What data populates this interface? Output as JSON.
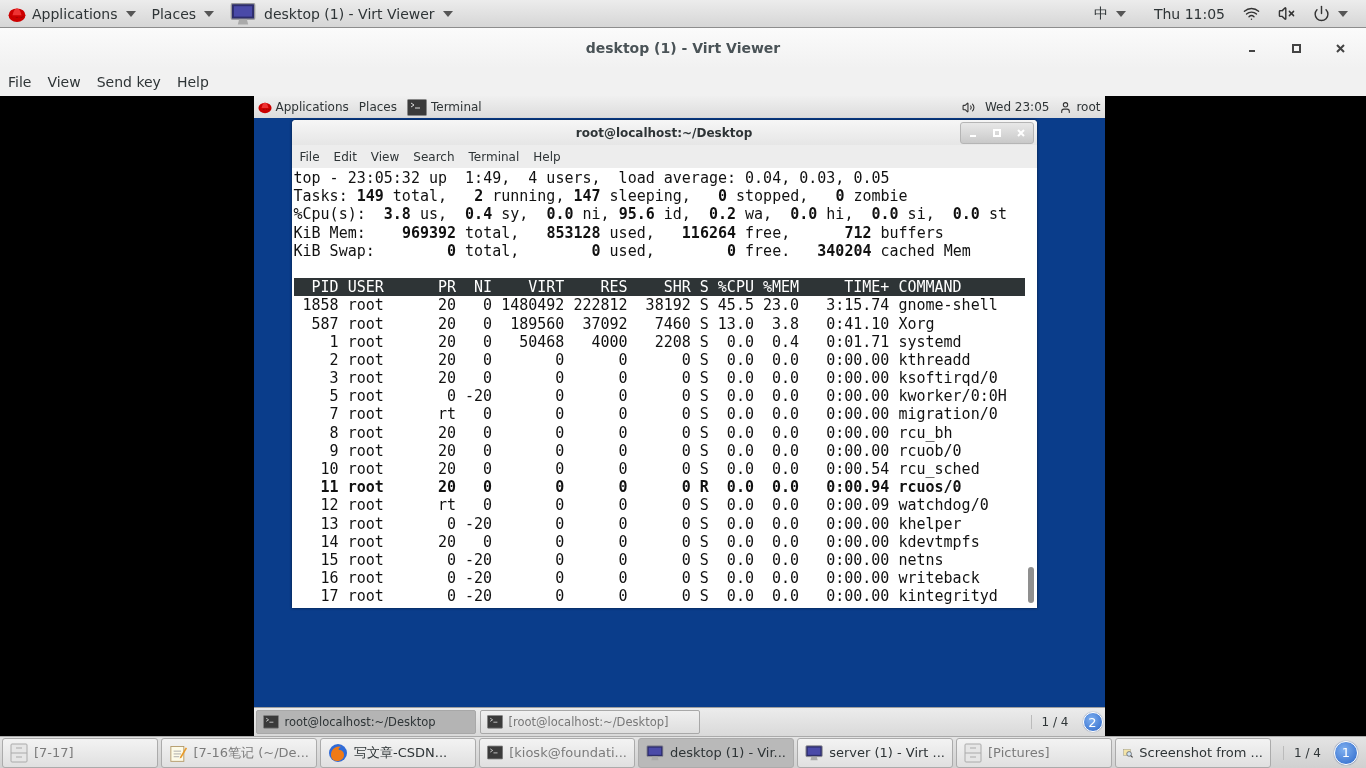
{
  "top_bar": {
    "menus": [
      "Applications",
      "Places"
    ],
    "window_menu": "desktop (1) - Virt Viewer",
    "input_method": "中",
    "clock": "Thu 11:05"
  },
  "window": {
    "title": "desktop (1) - Virt Viewer",
    "menu": [
      "File",
      "View",
      "Send key",
      "Help"
    ]
  },
  "guest": {
    "top_bar": {
      "menus": [
        "Applications",
        "Places"
      ],
      "active_app": "Terminal",
      "clock": "Wed 23:05",
      "user": "root"
    },
    "terminal": {
      "title": "root@localhost:~/Desktop",
      "menu": [
        "File",
        "Edit",
        "View",
        "Search",
        "Terminal",
        "Help"
      ],
      "summary": [
        "top - 23:05:32 up  1:49,  4 users,  load average: 0.04, 0.03, 0.05",
        "Tasks: **149** total,   **2** running, **147** sleeping,   **0** stopped,   **0** zombie",
        "%Cpu(s):  **3.8** us,  **0.4** sy,  **0.0** ni, **95.6** id,  **0.2** wa,  **0.0** hi,  **0.0** si,  **0.0** st",
        "KiB Mem:    **969392** total,   **853128** used,   **116264** free,      **712** buffers",
        "KiB Swap:        **0** total,        **0** used,        **0** free.   **340204** cached Mem"
      ],
      "columns": [
        "PID",
        "USER",
        "PR",
        "NI",
        "VIRT",
        "RES",
        "SHR",
        "S",
        "%CPU",
        "%MEM",
        "TIME+",
        "COMMAND"
      ],
      "processes": [
        {
          "cells": [
            "1858",
            "root",
            "20",
            "0",
            "1480492",
            "222812",
            "38192",
            "S",
            "45.5",
            "23.0",
            "3:15.74",
            "gnome-shell"
          ],
          "highlighted": false
        },
        {
          "cells": [
            "587",
            "root",
            "20",
            "0",
            "189560",
            "37092",
            "7460",
            "S",
            "13.0",
            "3.8",
            "0:41.10",
            "Xorg"
          ],
          "highlighted": false
        },
        {
          "cells": [
            "1",
            "root",
            "20",
            "0",
            "50468",
            "4000",
            "2208",
            "S",
            "0.0",
            "0.4",
            "0:01.71",
            "systemd"
          ],
          "highlighted": false
        },
        {
          "cells": [
            "2",
            "root",
            "20",
            "0",
            "0",
            "0",
            "0",
            "S",
            "0.0",
            "0.0",
            "0:00.00",
            "kthreadd"
          ],
          "highlighted": false
        },
        {
          "cells": [
            "3",
            "root",
            "20",
            "0",
            "0",
            "0",
            "0",
            "S",
            "0.0",
            "0.0",
            "0:00.00",
            "ksoftirqd/0"
          ],
          "highlighted": false
        },
        {
          "cells": [
            "5",
            "root",
            "0",
            "-20",
            "0",
            "0",
            "0",
            "S",
            "0.0",
            "0.0",
            "0:00.00",
            "kworker/0:0H"
          ],
          "highlighted": false
        },
        {
          "cells": [
            "7",
            "root",
            "rt",
            "0",
            "0",
            "0",
            "0",
            "S",
            "0.0",
            "0.0",
            "0:00.00",
            "migration/0"
          ],
          "highlighted": false
        },
        {
          "cells": [
            "8",
            "root",
            "20",
            "0",
            "0",
            "0",
            "0",
            "S",
            "0.0",
            "0.0",
            "0:00.00",
            "rcu_bh"
          ],
          "highlighted": false
        },
        {
          "cells": [
            "9",
            "root",
            "20",
            "0",
            "0",
            "0",
            "0",
            "S",
            "0.0",
            "0.0",
            "0:00.00",
            "rcuob/0"
          ],
          "highlighted": false
        },
        {
          "cells": [
            "10",
            "root",
            "20",
            "0",
            "0",
            "0",
            "0",
            "S",
            "0.0",
            "0.0",
            "0:00.54",
            "rcu_sched"
          ],
          "highlighted": false
        },
        {
          "cells": [
            "11",
            "root",
            "20",
            "0",
            "0",
            "0",
            "0",
            "R",
            "0.0",
            "0.0",
            "0:00.94",
            "rcuos/0"
          ],
          "highlighted": true
        },
        {
          "cells": [
            "12",
            "root",
            "rt",
            "0",
            "0",
            "0",
            "0",
            "S",
            "0.0",
            "0.0",
            "0:00.09",
            "watchdog/0"
          ],
          "highlighted": false
        },
        {
          "cells": [
            "13",
            "root",
            "0",
            "-20",
            "0",
            "0",
            "0",
            "S",
            "0.0",
            "0.0",
            "0:00.00",
            "khelper"
          ],
          "highlighted": false
        },
        {
          "cells": [
            "14",
            "root",
            "20",
            "0",
            "0",
            "0",
            "0",
            "S",
            "0.0",
            "0.0",
            "0:00.00",
            "kdevtmpfs"
          ],
          "highlighted": false
        },
        {
          "cells": [
            "15",
            "root",
            "0",
            "-20",
            "0",
            "0",
            "0",
            "S",
            "0.0",
            "0.0",
            "0:00.00",
            "netns"
          ],
          "highlighted": false
        },
        {
          "cells": [
            "16",
            "root",
            "0",
            "-20",
            "0",
            "0",
            "0",
            "S",
            "0.0",
            "0.0",
            "0:00.00",
            "writeback"
          ],
          "highlighted": false
        },
        {
          "cells": [
            "17",
            "root",
            "0",
            "-20",
            "0",
            "0",
            "0",
            "S",
            "0.0",
            "0.0",
            "0:00.00",
            "kintegrityd"
          ],
          "highlighted": false
        }
      ]
    },
    "taskbar": {
      "tasks": [
        {
          "label": "root@localhost:~/Desktop",
          "selected": true,
          "minimized": false
        },
        {
          "label": "[root@localhost:~/Desktop]",
          "selected": false,
          "minimized": true
        }
      ],
      "workspace": "1 / 4",
      "badge": "2"
    }
  },
  "taskbar": {
    "tasks": [
      {
        "kind": "cabinet",
        "label": "[7-17]",
        "selected": false,
        "minimized": true
      },
      {
        "kind": "notes",
        "label": "[7-16笔记 (~/De...",
        "selected": false,
        "minimized": true
      },
      {
        "kind": "browser",
        "label": "写文章-CSDN...",
        "selected": false,
        "minimized": false
      },
      {
        "kind": "terminal",
        "label": "[kiosk@foundati...",
        "selected": false,
        "minimized": true
      },
      {
        "kind": "monitor",
        "label": "desktop (1) - Vir...",
        "selected": true,
        "minimized": false
      },
      {
        "kind": "monitor",
        "label": "server (1) - Virt ...",
        "selected": false,
        "minimized": false
      },
      {
        "kind": "cabinet",
        "label": "[Pictures]",
        "selected": false,
        "minimized": true
      },
      {
        "kind": "viewer",
        "label": "Screenshot from ...",
        "selected": false,
        "minimized": false
      }
    ],
    "workspace": "1 / 4",
    "badge": "1"
  }
}
